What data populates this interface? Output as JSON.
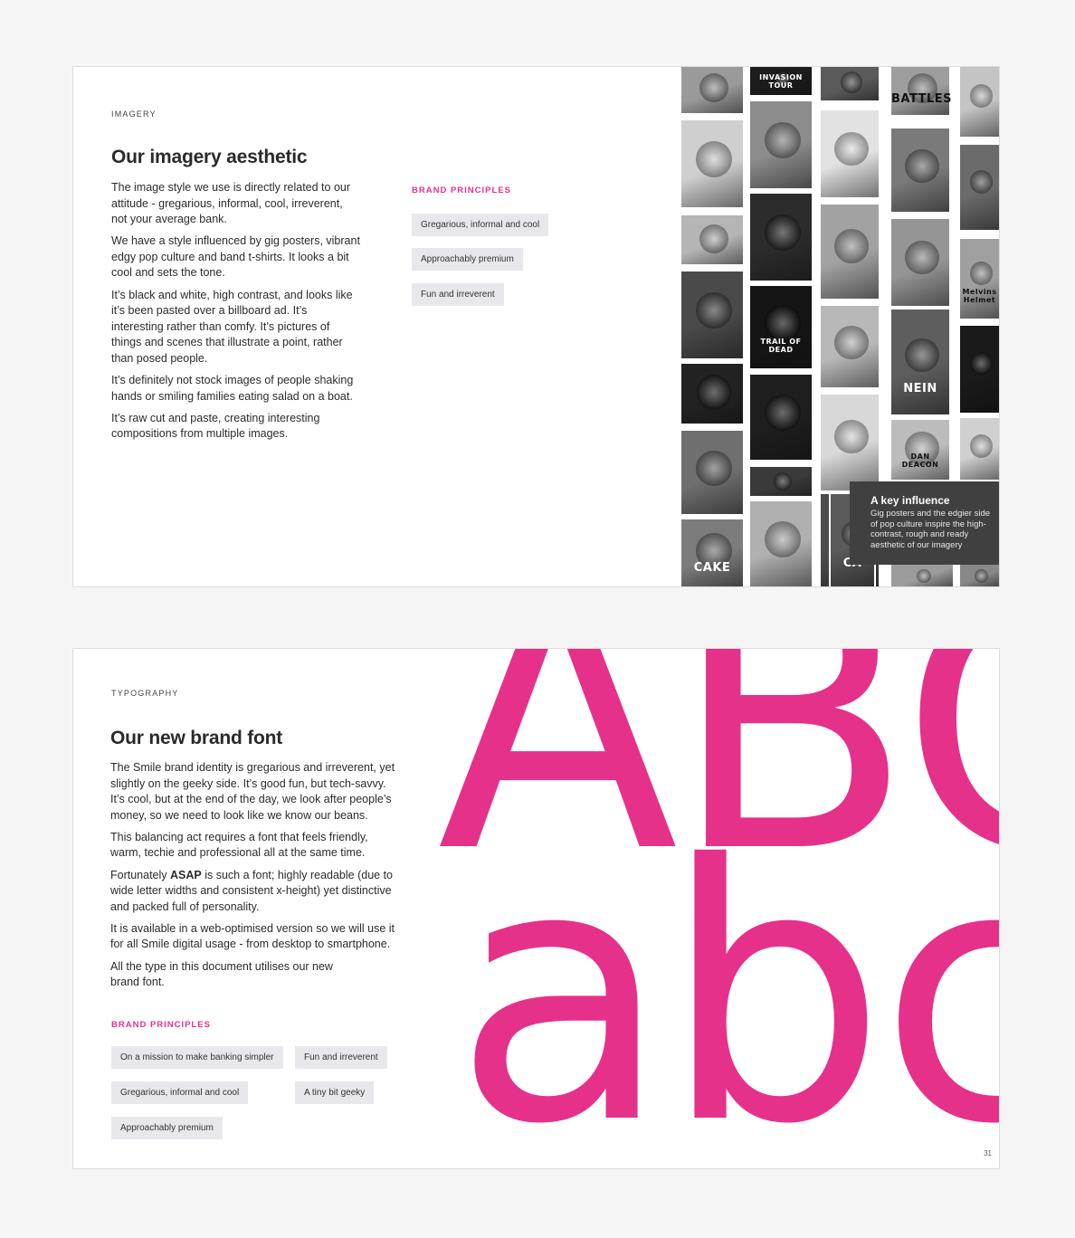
{
  "imagery_page": {
    "section_label": "IMAGERY",
    "heading": "Our imagery aesthetic",
    "paragraphs": [
      "The image style we use is directly related to our attitude - gregarious, informal, cool, irreverent, not your average bank.",
      "We have a style influenced by gig posters, vibrant edgy pop culture and band t-shirts. It looks a bit cool and sets the tone.",
      "It’s black and white, high contrast, and looks like it’s been pasted over a billboard ad. It’s interesting rather than comfy. It’s pictures of things and scenes that illustrate a point, rather than posed people.",
      "It’s definitely not stock images of people shaking hands or smiling families eating salad on a boat.",
      "It’s raw cut and paste, creating interesting compositions from multiple images."
    ],
    "brand_principles_title": "BRAND PRINCIPLES",
    "principles": [
      "Gregarious, informal and cool",
      "Approachably premium",
      "Fun and irreverent"
    ],
    "posters": [
      {
        "text": "",
        "shade": "#9a9a9a"
      },
      {
        "text": "",
        "shade": "#cfcfcf"
      },
      {
        "text": "",
        "shade": "#b5b5b5"
      },
      {
        "text": "",
        "shade": "#4a4a4a"
      },
      {
        "text": "",
        "shade": "#222222"
      },
      {
        "text": "",
        "shade": "#6f6f6f"
      },
      {
        "text": "",
        "shade": "#c8c8c8"
      },
      {
        "text": "INVASION TOUR",
        "shade": "#1c1c1c"
      },
      {
        "text": "",
        "shade": "#8c8c8c"
      },
      {
        "text": "",
        "shade": "#2c2c2c"
      },
      {
        "text": "TRAIL OF DEAD",
        "shade": "#151515"
      },
      {
        "text": "",
        "shade": "#1e1e1e"
      },
      {
        "text": "",
        "shade": "#3a3a3a"
      },
      {
        "text": "",
        "shade": "#262626"
      },
      {
        "text": "",
        "shade": "#5a5a5a"
      },
      {
        "text": "",
        "shade": "#e2e2e2"
      },
      {
        "text": "",
        "shade": "#a2a2a2"
      },
      {
        "text": "",
        "shade": "#b8b8b8"
      },
      {
        "text": "",
        "shade": "#d8d8d8"
      },
      {
        "text": "",
        "shade": "#8a8a8a"
      },
      {
        "text": "BATTLES",
        "shade": "#9e9e9e"
      },
      {
        "text": "",
        "shade": "#7a7a7a"
      },
      {
        "text": "",
        "shade": "#959595"
      },
      {
        "text": "NEIN",
        "shade": "#5e5e5e"
      },
      {
        "text": "DAN DEACON",
        "shade": "#bcbcbc"
      },
      {
        "text": "",
        "shade": "#c4c4c4"
      },
      {
        "text": "",
        "shade": "#6b6b6b"
      },
      {
        "text": "Melvins Helmet",
        "shade": "#a0a0a0"
      },
      {
        "text": "",
        "shade": "#1a1a1a"
      },
      {
        "text": "",
        "shade": "#d0d0d0"
      },
      {
        "text": "",
        "shade": "#888888"
      },
      {
        "text": "",
        "shade": "#9c9c9c"
      },
      {
        "text": "CAKE",
        "shade": "#7c7c7c"
      },
      {
        "text": "",
        "shade": "#cacaca"
      },
      {
        "text": "",
        "shade": "#4c4c4c"
      },
      {
        "text": "CA",
        "shade": "#5a5a5a"
      },
      {
        "text": "",
        "shade": "#b0b0b0"
      }
    ],
    "caption": {
      "title": "A key influence",
      "body": "Gig posters and the edgier side of pop culture inspire the high-contrast, rough and ready aesthetic of our imagery"
    }
  },
  "typography_page": {
    "section_label": "TYPOGRAPHY",
    "heading": "Our new brand font",
    "p1": "The Smile brand identity is gregarious and irreverent, yet slightly on the geeky side. It’s good fun, but tech-savvy. It’s cool, but at the end of the day, we look after people’s money, so we need to look like we know our beans.",
    "p2": "This balancing act requires a font that feels friendly, warm, techie and professional all at the same time.",
    "p3_before": "Fortunately ",
    "p3_bold": "ASAP",
    "p3_after": " is such a font; highly readable (due to wide letter widths and consistent x-height) yet distinctive and packed full of personality.",
    "p4": "It is available in a web-optimised version so we will use it for all Smile digital usage - from desktop to smartphone.",
    "p5": "All the type in this document utilises our new brand font.",
    "brand_principles_title": "BRAND PRINCIPLES",
    "principles": [
      "On a mission to make banking simpler",
      "Fun and irreverent",
      "Gregarious, informal and cool",
      "A tiny bit geeky",
      "Approachably premium"
    ],
    "big_upper": "ABC",
    "big_lower": "abc",
    "page_number": "31"
  },
  "colors": {
    "accent": "#e6318a",
    "caption_bg": "#404040",
    "chip_bg": "#e8e8ec"
  }
}
